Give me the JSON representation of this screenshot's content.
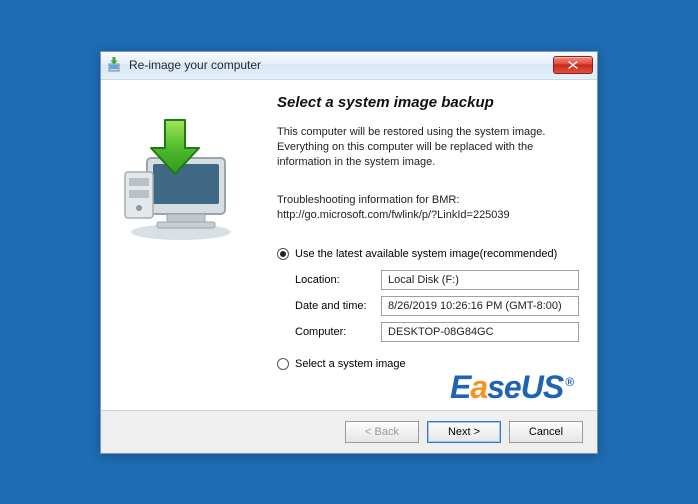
{
  "window": {
    "title": "Re-image your computer"
  },
  "heading": "Select a system image backup",
  "description": "This computer will be restored using the system image. Everything on this computer will be replaced with the information in the system image.",
  "troubleshoot_label": "Troubleshooting information for BMR:",
  "troubleshoot_link": "http://go.microsoft.com/fwlink/p/?LinkId=225039",
  "options": {
    "use_latest_label": "Use the latest available system image(recommended)",
    "select_image_label": "Select a system image",
    "selected": "use_latest"
  },
  "fields": {
    "location_label": "Location:",
    "location_value": "Local Disk (F:)",
    "datetime_label": "Date and time:",
    "datetime_value": "8/26/2019 10:26:16 PM (GMT-8:00)",
    "computer_label": "Computer:",
    "computer_value": "DESKTOP-08G84GC"
  },
  "buttons": {
    "back": "< Back",
    "next": "Next >",
    "cancel": "Cancel"
  },
  "watermark": {
    "brand_e": "E",
    "brand_a": "a",
    "brand_rest": "seUS",
    "reg": "®"
  }
}
